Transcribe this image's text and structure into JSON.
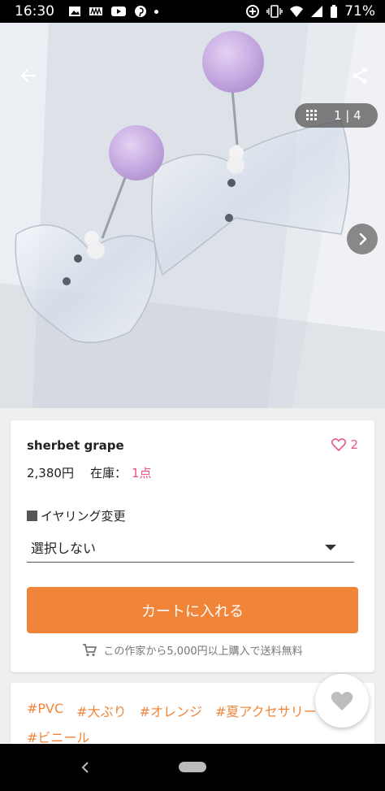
{
  "status_bar": {
    "time": "16:30",
    "battery": "71%",
    "icons": [
      "image-icon",
      "news-icon",
      "youtube-icon",
      "pinterest-icon",
      "dot-icon",
      "data-saver-icon",
      "vibrate-icon",
      "wifi-icon",
      "signal-icon",
      "battery-icon"
    ]
  },
  "gallery": {
    "counter": "1 | 4",
    "icons": [
      "back-arrow-icon",
      "share-icon",
      "grid-icon",
      "chevron-right-icon"
    ]
  },
  "product": {
    "title": "sherbet grape",
    "favorites": "2",
    "price": "2,380円",
    "stock_label": "在庫：",
    "stock_value": "1点"
  },
  "option": {
    "label": "イヤリング変更",
    "selected": "選択しない"
  },
  "cart": {
    "button_label": "カートに入れる",
    "shipping_note": "この作家から5,000円以上購入で送料無料"
  },
  "tags": [
    "#PVC",
    "#大ぶり",
    "#オレンジ",
    "#夏アクセサリー",
    "#ビニール"
  ],
  "colors": {
    "accent_orange": "#f0853a",
    "favorite_pink": "#e8538a"
  }
}
